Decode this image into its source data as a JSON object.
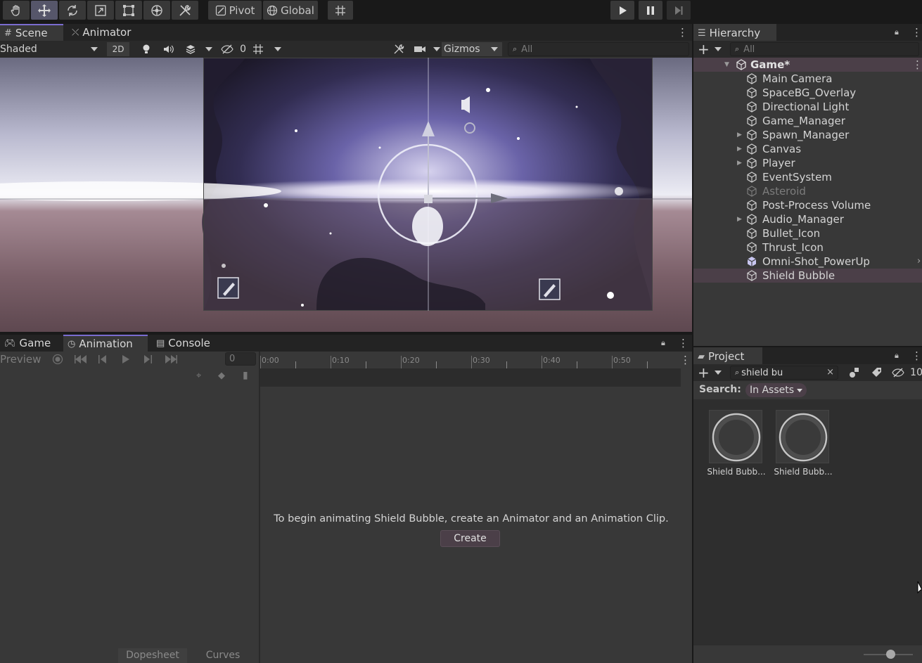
{
  "toolbar": {
    "tools": [
      "hand-tool",
      "move-tool",
      "rotate-tool",
      "scale-tool",
      "rect-tool",
      "transform-tool",
      "custom-tool"
    ],
    "pivot_label": "Pivot",
    "global_label": "Global"
  },
  "scene_panel": {
    "tabs": [
      {
        "label": "Scene"
      },
      {
        "label": "Animator"
      }
    ],
    "shading_mode": "Shaded",
    "mode_2d": "2D",
    "hidden_count": "0",
    "gizmos_label": "Gizmos",
    "search_placeholder": "All"
  },
  "hierarchy": {
    "tab_label": "Hierarchy",
    "search_placeholder": "All",
    "scene_name": "Game*",
    "items": [
      {
        "label": "Main Camera",
        "expandable": false
      },
      {
        "label": "SpaceBG_Overlay",
        "expandable": false
      },
      {
        "label": "Directional Light",
        "expandable": false
      },
      {
        "label": "Game_Manager",
        "expandable": false
      },
      {
        "label": "Spawn_Manager",
        "expandable": true
      },
      {
        "label": "Canvas",
        "expandable": true
      },
      {
        "label": "Player",
        "expandable": true
      },
      {
        "label": "EventSystem",
        "expandable": false
      },
      {
        "label": "Asteroid",
        "expandable": false,
        "inactive": true
      },
      {
        "label": "Post-Process Volume",
        "expandable": false
      },
      {
        "label": "Audio_Manager",
        "expandable": true
      },
      {
        "label": "Bullet_Icon",
        "expandable": false
      },
      {
        "label": "Thrust_Icon",
        "expandable": false
      },
      {
        "label": "Omni-Shot_PowerUp",
        "expandable": false,
        "prefab": true
      },
      {
        "label": "Shield Bubble",
        "expandable": false,
        "selected": true
      }
    ]
  },
  "bottom_tabs": [
    {
      "label": "Game"
    },
    {
      "label": "Animation"
    },
    {
      "label": "Console"
    }
  ],
  "animation": {
    "preview_label": "Preview",
    "frame_value": "0",
    "timeline_ticks": [
      "0:00",
      "0:10",
      "0:20",
      "0:30",
      "0:40",
      "0:50"
    ],
    "message": "To begin animating Shield Bubble, create an Animator and an Animation Clip.",
    "create_label": "Create",
    "dopesheet_label": "Dopesheet",
    "curves_label": "Curves"
  },
  "project": {
    "tab_label": "Project",
    "search_value": "shield bu",
    "hidden_count": "10",
    "search_label": "Search:",
    "scope_label": "In Assets",
    "assets": [
      {
        "label": "Shield Bubb..."
      },
      {
        "label": "Shield Bubb..."
      }
    ]
  },
  "colors": {
    "selection": "#4b3f48",
    "accent": "#7a6cd0",
    "panel": "#383838"
  }
}
